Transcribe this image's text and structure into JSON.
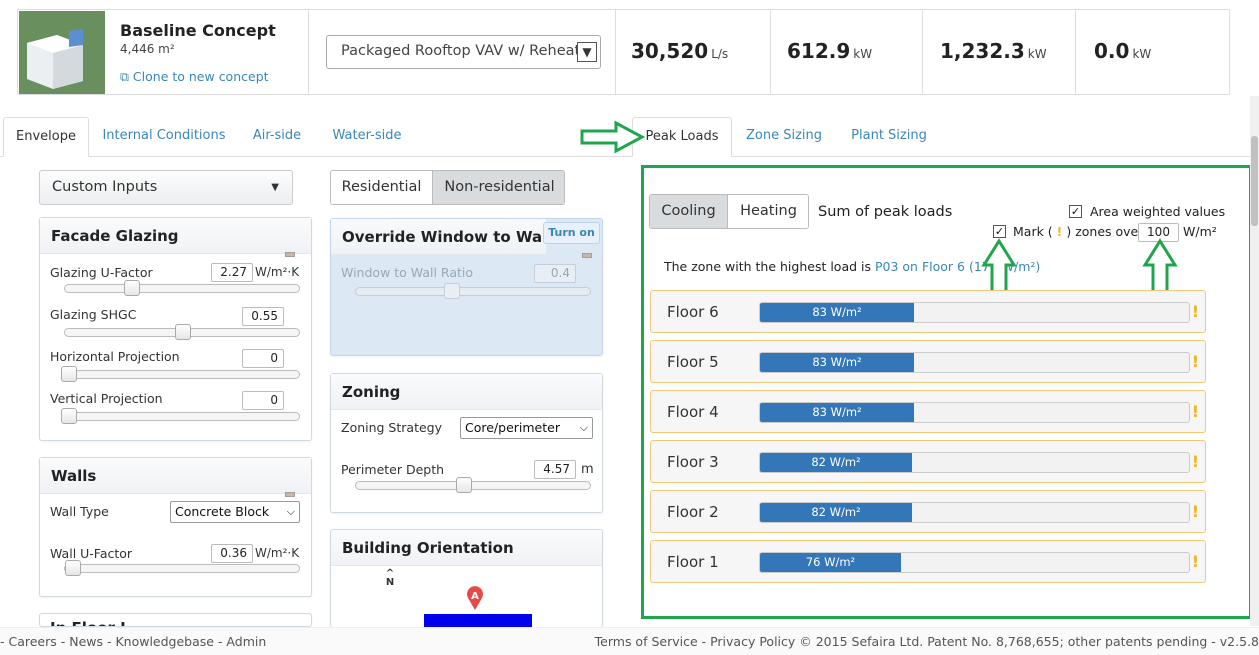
{
  "header": {
    "concept_title": "Baseline Concept",
    "area": "4,446 m²",
    "clone_link": "Clone to new concept",
    "hvac_system": "Packaged Rooftop VAV w/ Reheat",
    "metrics": [
      {
        "value": "30,520",
        "unit": "L/s"
      },
      {
        "value": "612.9",
        "unit": "kW"
      },
      {
        "value": "1,232.3",
        "unit": "kW"
      },
      {
        "value": "0.0",
        "unit": "kW"
      }
    ]
  },
  "tabs": [
    "Envelope",
    "Internal Conditions",
    "Air-side",
    "Water-side",
    "Peak Loads",
    "Zone Sizing",
    "Plant Sizing"
  ],
  "left": {
    "preset": "Custom Inputs",
    "facade": {
      "title": "Facade Glazing",
      "glazing_u_label": "Glazing U-Factor",
      "glazing_u_value": "2.27",
      "glazing_u_unit": "W/m²·K",
      "glazing_u_level": 0.27,
      "shgc_label": "Glazing SHGC",
      "shgc_value": "0.55",
      "shgc_level": 0.5,
      "hproj_label": "Horizontal Projection",
      "hproj_value": "0",
      "vproj_label": "Vertical Projection",
      "vproj_value": "0"
    },
    "walls": {
      "title": "Walls",
      "type_label": "Wall Type",
      "type_value": "Concrete Block",
      "u_label": "Wall U-Factor",
      "u_value": "0.36",
      "u_unit": "W/m²·K"
    },
    "next_panel_title": "In Floor I"
  },
  "middle": {
    "seg": [
      "Residential",
      "Non-residential"
    ],
    "override": {
      "title": "Override Window to Wall Ratio",
      "turn_on": "Turn on",
      "wwr_label": "Window to Wall Ratio",
      "wwr_value": "0.4"
    },
    "zoning": {
      "title": "Zoning",
      "strategy_label": "Zoning Strategy",
      "strategy_value": "Core/perimeter",
      "depth_label": "Perimeter Depth",
      "depth_value": "4.57",
      "depth_unit": "m"
    },
    "orientation": {
      "title": "Building Orientation",
      "north_glyph": "N",
      "marker_letter": "A"
    }
  },
  "peak": {
    "toggle": [
      "Cooling",
      "Heating"
    ],
    "sum_label": "Sum of peak loads",
    "area_weighted_label": "Area weighted values",
    "mark_label_pre": "Mark (",
    "mark_label_post": ") zones over",
    "threshold": "100",
    "threshold_unit": "W/m²",
    "highest_prefix": "The zone with the highest load is ",
    "highest_link": "P03 on Floor 6 (175 W/m²)",
    "floors": [
      {
        "name": "Floor 6",
        "value": 83,
        "label": "83  W/m²"
      },
      {
        "name": "Floor 5",
        "value": 83,
        "label": "83  W/m²"
      },
      {
        "name": "Floor 4",
        "value": 83,
        "label": "83  W/m²"
      },
      {
        "name": "Floor 3",
        "value": 82,
        "label": "82  W/m²"
      },
      {
        "name": "Floor 2",
        "value": 82,
        "label": "82  W/m²"
      },
      {
        "name": "Floor 1",
        "value": 76,
        "label": "76  W/m²"
      }
    ],
    "scale_max": 232
  },
  "colors": {
    "accent": "#3477b8",
    "highlight_green": "#1fa54b",
    "warning": "#f0b429"
  },
  "footer": {
    "left": "- Careers - News - Knowledgebase - Admin",
    "right": "Terms of Service - Privacy Policy © 2015 Sefaira Ltd. Patent No. 8,768,655; other patents pending - v2.5.8"
  }
}
